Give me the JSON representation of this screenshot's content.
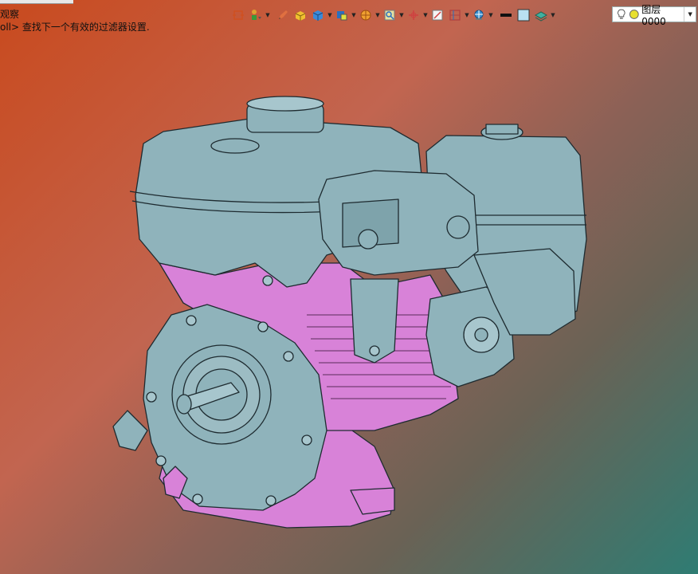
{
  "status": {
    "line1": "观察",
    "line2": "oll> 查找下一个有效的过滤器设置."
  },
  "toolbar": {
    "icons": [
      "frame-icon",
      "filter-person-icon",
      "pencil-icon",
      "solid-box-icon",
      "cube-icon",
      "render-icon",
      "sphere-icon",
      "zoom-icon",
      "axis-icon",
      "view-icon",
      "layout-icon",
      "globe-icon",
      "line-color-icon",
      "fill-color-icon",
      "layer-stack-icon"
    ],
    "line_color": "#111111",
    "fill_color": "#b9e0f2"
  },
  "layer": {
    "label": "图层0000"
  },
  "colors": {
    "engine_body": "#8fb3bb",
    "engine_accent": "#d882d8",
    "edge": "#1e2b30"
  }
}
